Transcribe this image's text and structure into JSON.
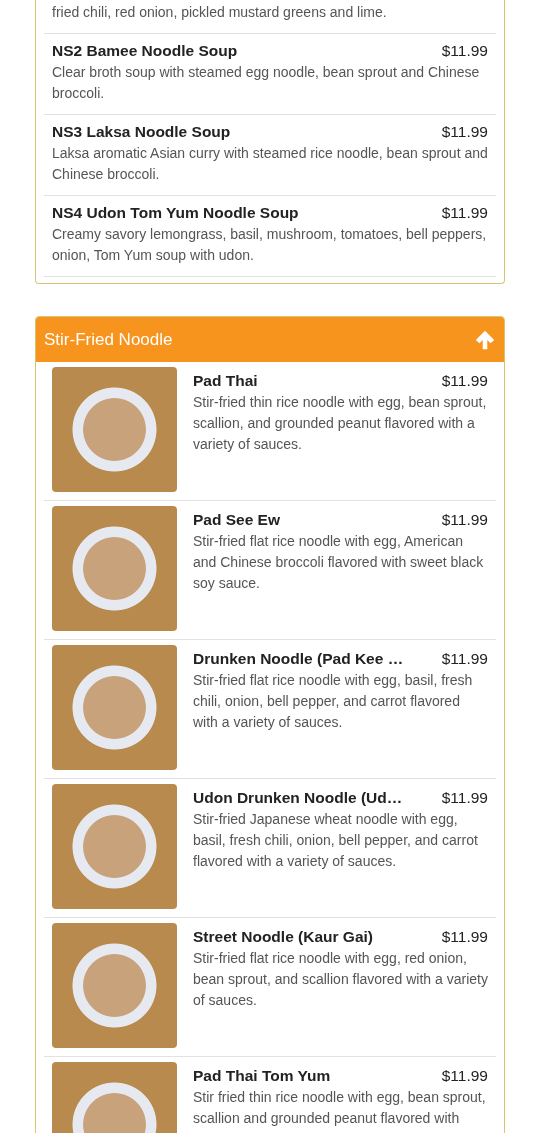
{
  "sections": [
    {
      "items": [
        {
          "kind": "text",
          "description": "fried chili, red onion, pickled mustard greens and lime."
        },
        {
          "kind": "text",
          "name": "NS2 Bamee Noodle Soup",
          "price": "$11.99",
          "description": "Clear broth soup with steamed egg noodle, bean sprout and Chinese broccoli."
        },
        {
          "kind": "text",
          "name": "NS3 Laksa Noodle Soup",
          "price": "$11.99",
          "description": "Laksa aromatic Asian curry with steamed rice noodle, bean sprout and Chinese broccoli."
        },
        {
          "kind": "text",
          "name": "NS4 Udon Tom Yum Noodle Soup",
          "price": "$11.99",
          "description": "Creamy savory lemongrass, basil, mushroom, tomatoes, bell peppers, onion, Tom Yum soup with udon."
        }
      ]
    },
    {
      "title": "Stir-Fried Noodle",
      "expanded": true,
      "items": [
        {
          "kind": "photo",
          "name": "Pad Thai",
          "price": "$11.99",
          "description": "Stir-fried thin rice noodle with egg, bean sprout, scallion, and grounded peanut flavored with a variety of sauces."
        },
        {
          "kind": "photo",
          "name": "Pad See Ew",
          "price": "$11.99",
          "description": "Stir-fried flat rice noodle with egg, American and Chinese broccoli flavored with sweet black soy sauce."
        },
        {
          "kind": "photo",
          "name": "Drunken Noodle (Pad Kee …",
          "price": "$11.99",
          "description": "Stir-fried flat rice noodle with egg, basil, fresh chili, onion, bell pepper, and carrot flavored with a variety of sauces."
        },
        {
          "kind": "photo",
          "name": "Udon Drunken Noodle (Ud…",
          "price": "$11.99",
          "description": "Stir-fried Japanese wheat noodle with egg, basil, fresh chili, onion, bell pepper, and carrot flavored with a variety of sauces."
        },
        {
          "kind": "photo",
          "name": "Street Noodle (Kaur Gai)",
          "price": "$11.99",
          "description": "Stir-fried flat rice noodle with egg, red onion, bean sprout, and scallion flavored with a variety of sauces."
        },
        {
          "kind": "photo",
          "name": "Pad Thai Tom Yum",
          "price": "$11.99",
          "description": "Stir fried thin rice noodle with egg, bean sprout, scallion and grounded peanut flavored with"
        }
      ]
    }
  ]
}
